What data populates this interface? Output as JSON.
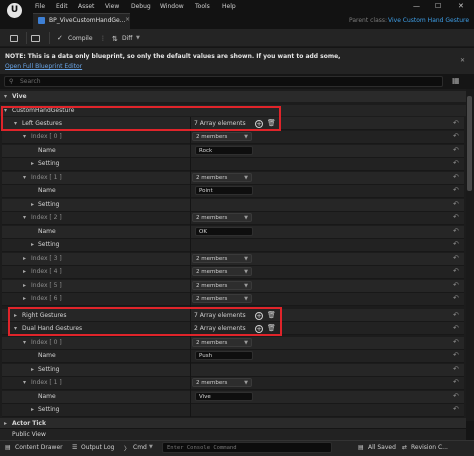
{
  "logo": {
    "text": "U"
  },
  "menu": [
    "File",
    "Edit",
    "Asset",
    "View",
    "Debug",
    "Window",
    "Tools",
    "Help"
  ],
  "window_controls": {
    "minimize": "—",
    "maximize": "☐",
    "close": "✕"
  },
  "tab": {
    "title": "BP_ViveCustomHandGe...",
    "close": "×"
  },
  "parent_class": {
    "label": "Parent class:",
    "value": "Vive Custom Hand Gesture"
  },
  "toolbar": {
    "compile": "Compile",
    "diff": "Diff"
  },
  "note": {
    "text": "NOTE: This is a data only blueprint, so only the default values are shown.  If you want to add some,",
    "link": "Open Full Blueprint Editor"
  },
  "search": {
    "placeholder": "Search"
  },
  "details": {
    "category": "Vive",
    "group": "CustomHandGesture",
    "left_gestures": {
      "label": "Left Gestures",
      "value": "7 Array elements"
    },
    "index0": {
      "label": "Index [ 0 ]",
      "members": "2 members",
      "name_label": "Name",
      "name_value": "Rock",
      "setting_label": "Setting"
    },
    "index1": {
      "label": "Index [ 1 ]",
      "members": "2 members",
      "name_label": "Name",
      "name_value": "Point",
      "setting_label": "Setting"
    },
    "index2": {
      "label": "Index [ 2 ]",
      "members": "2 members",
      "name_label": "Name",
      "name_value": "OK",
      "setting_label": "Setting"
    },
    "index3": {
      "label": "Index [ 3 ]",
      "members": "2 members"
    },
    "index4": {
      "label": "Index [ 4 ]",
      "members": "2 members"
    },
    "index5": {
      "label": "Index [ 5 ]",
      "members": "2 members"
    },
    "index6": {
      "label": "Index [ 6 ]",
      "members": "2 members"
    },
    "right_gestures": {
      "label": "Right Gestures",
      "value": "7 Array elements"
    },
    "dual_gestures": {
      "label": "Dual Hand Gestures",
      "value": "2 Array elements"
    },
    "dual_index0": {
      "label": "Index [ 0 ]",
      "members": "2 members",
      "name_label": "Name",
      "name_value": "Push",
      "setting_label": "Setting"
    },
    "dual_index1": {
      "label": "Index [ 1 ]",
      "members": "2 members",
      "name_label": "Name",
      "name_value": "Vive",
      "setting_label": "Setting"
    }
  },
  "bottom": {
    "actor_tick": "Actor Tick",
    "public_view": "Public View"
  },
  "statusbar": {
    "content_drawer": "Content Drawer",
    "output_log": "Output Log",
    "cmd": "Cmd",
    "console_placeholder": "Enter Console Command",
    "all_saved": "All Saved",
    "revision": "Revision C..."
  },
  "colors": {
    "highlight": "#e0242a",
    "link": "#6aa6e8",
    "parent_value": "#3e9fe8"
  }
}
